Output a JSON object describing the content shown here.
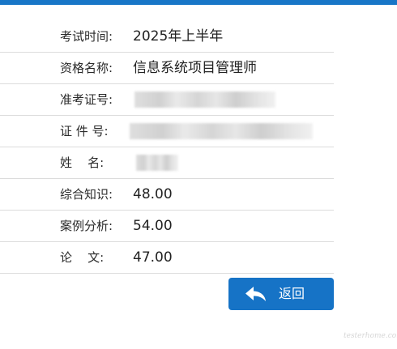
{
  "rows": [
    {
      "label": "考试时间:",
      "value": "2025年上半年"
    },
    {
      "label": "资格名称:",
      "value": "信息系统项目管理师"
    },
    {
      "label": "准考证号:",
      "value": ""
    },
    {
      "label": "证 件 号:",
      "value": ""
    },
    {
      "label": "姓    名:",
      "value": ""
    },
    {
      "label": "综合知识:",
      "value": "48.00"
    },
    {
      "label": "案例分析:",
      "value": "54.00"
    },
    {
      "label": "论    文:",
      "value": "47.00"
    }
  ],
  "return_button": {
    "label": "返回",
    "icon": "back-arrow-icon"
  },
  "watermark": "testerhome.com",
  "colors": {
    "accent": "#1673c6",
    "divider": "#dcdcdc"
  }
}
